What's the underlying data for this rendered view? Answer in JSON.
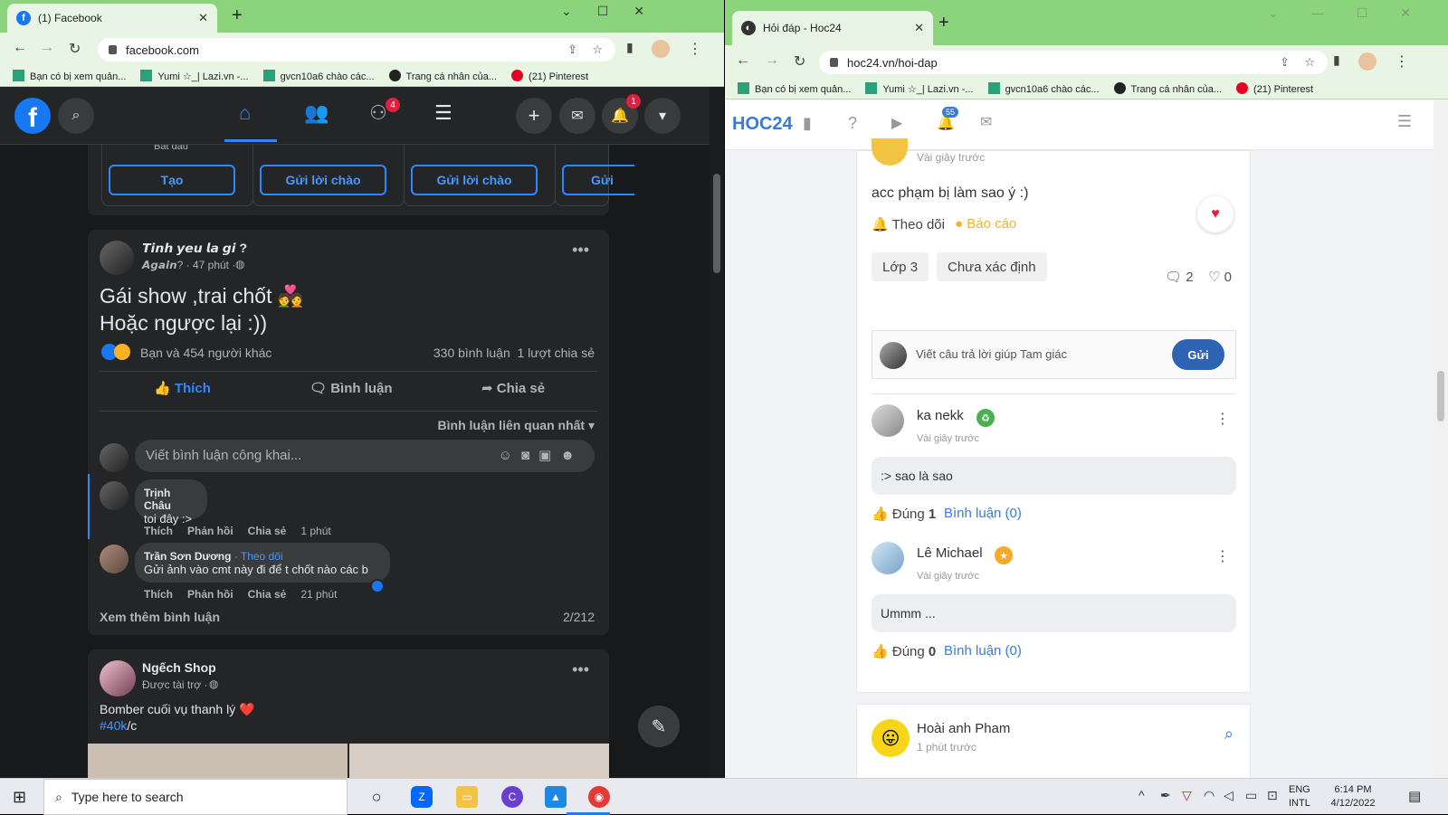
{
  "fb_browser": {
    "tab_title": "(1) Facebook",
    "url": "facebook.com",
    "bookmarks": [
      "Bạn có bị xem quản...",
      "Yumi ☆_| Lazi.vn -...",
      "gvcn10a6 chào các...",
      "Trang cá nhân của...",
      "(21) Pinterest"
    ]
  },
  "fb": {
    "badges": {
      "groups": "4",
      "notifications": "1"
    },
    "suggest": {
      "caption": "Bắt đầu",
      "buttons": [
        "Tạo",
        "Gửi lời chào",
        "Gửi lời chào",
        "Gửi"
      ]
    },
    "post": {
      "author": "𝙏𝙞𝙣𝙝 𝙮𝙚𝙪 𝙡𝙖 𝙜𝙞 ?",
      "meta": "𝘼𝙜𝙖𝙞𝙣? · 47 phút ·",
      "text1": "Gái show ,trai chốt 💑",
      "text2": "Hoặc ngược lại :))",
      "reactions": "Bạn và 454 người khác",
      "counts": "330 bình luận  1 lượt chia sẻ",
      "actions": {
        "like": "Thích",
        "comment": "Bình luận",
        "share": "Chia sẻ"
      },
      "sort": "Bình luận liên quan nhất",
      "comment_placeholder": "Viết bình luận công khai...",
      "comments": [
        {
          "name": "Trịnh Châu",
          "text": "toi đây :>",
          "actions": [
            "Thích",
            "Phản hồi",
            "Chia sẻ",
            "1 phút"
          ]
        },
        {
          "name": "Trần Sơn Dương",
          "follow": "· Theo dõi",
          "text": "Gửi ảnh vào cmt này đi để t chốt nào các b",
          "actions": [
            "Thích",
            "Phản hồi",
            "Chia sẻ",
            "21 phút"
          ]
        }
      ],
      "more": "Xem thêm bình luận",
      "pager": "2/212"
    },
    "post2": {
      "author": "Ngếch Shop",
      "meta": "Được tài trợ ·",
      "text": "Bomber cuối vụ thanh lý ❤️",
      "tag": "#40k",
      "tag_suffix": "/c"
    }
  },
  "h_browser": {
    "tab_title": "Hỏi đáp - Hoc24",
    "url": "hoc24.vn/hoi-dap",
    "bookmarks": [
      "Bạn có bị xem quản...",
      "Yumi ☆_| Lazi.vn -...",
      "gvcn10a6 chào các...",
      "Trang cá nhân của...",
      "(21) Pinterest"
    ]
  },
  "hoc24": {
    "logo": "HOC24",
    "notif_count": "55",
    "q": {
      "time": "Vài giây trước",
      "text": "acc phạm bị làm sao ý :)",
      "follow": "Theo dõi",
      "report": "Báo cáo",
      "tags": [
        "Lớp 3",
        "Chưa xác định"
      ],
      "comments": "2",
      "likes": "0",
      "answer_placeholder": "Viết câu trả lời giúp Tam giác",
      "send": "Gửi"
    },
    "answers": [
      {
        "name": "ka nekk",
        "time": "Vài giây trước",
        "text": ":> sao là sao",
        "correct_label": "Đúng",
        "correct": "1",
        "comments": "Bình luận (0)"
      },
      {
        "name": "Lê Michael",
        "time": "Vài giây trước",
        "text": "Ummm ...",
        "correct_label": "Đúng",
        "correct": "0",
        "comments": "Bình luận (0)"
      }
    ],
    "next": {
      "name": "Hoài anh Pham",
      "time": "1 phút trước"
    }
  },
  "taskbar": {
    "search_placeholder": "Type here to search",
    "lang1": "ENG",
    "lang2": "INTL",
    "time": "6:14 PM",
    "date": "4/12/2022"
  },
  "colors": {
    "fb_blue": "#1877f2",
    "hoc_blue": "#3a7bd5",
    "chrome_green": "#8bd47c"
  }
}
